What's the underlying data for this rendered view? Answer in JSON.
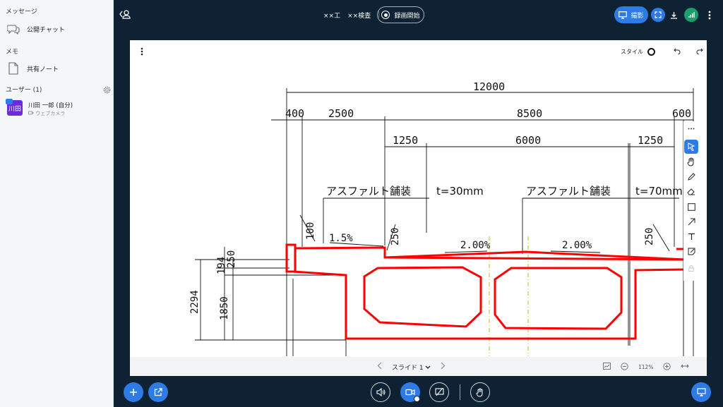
{
  "sidebar": {
    "messages_title": "メッセージ",
    "public_chat": "公開チャット",
    "memo_title": "メモ",
    "shared_note": "共有ノート",
    "users_title": "ユーザー (1)",
    "user": {
      "avatar_text": "川田",
      "name": "川田 一郎 (自分)",
      "sub": "ウェブカメラ"
    }
  },
  "topbar": {
    "title_part1": "××工",
    "title_part2": "××検査",
    "record_label": "録画開始",
    "share_label": "撮影"
  },
  "slide": {
    "style_label": "スタイル",
    "page_label": "スライド 1",
    "zoom": "112%"
  },
  "drawing": {
    "dims": {
      "total": "12000",
      "d400": "400",
      "d2500": "2500",
      "d8500": "8500",
      "d600": "600",
      "d1250a": "1250",
      "d6000": "6000",
      "d1250b": "1250",
      "h2294": "2294",
      "h1850": "1850",
      "h194": "194",
      "h250": "250",
      "v100": "100",
      "v250a": "250",
      "v250b": "250"
    },
    "pave_left": "アスファルト舗装",
    "pave_left_t": "t=30mm",
    "pave_right": "アスファルト舗装",
    "pave_right_t": "t=70mm",
    "slope1": "1.5%",
    "slope2": "2.00%",
    "slope3": "2.00%"
  },
  "colors": {
    "accent": "#2f7be5",
    "dark": "#0e2233",
    "red": "#ff0000"
  }
}
